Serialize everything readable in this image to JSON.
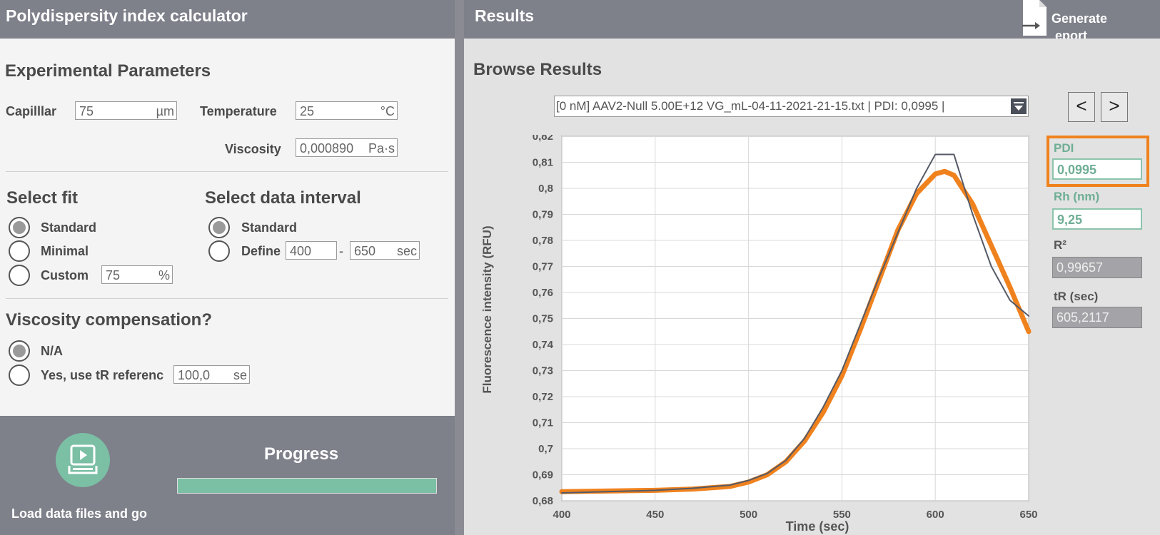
{
  "left_title": "Polydispersity index calculator",
  "right_title": "Results",
  "generate_report": {
    "line1": "Generate",
    "line2": "eport"
  },
  "experimental": {
    "title": "Experimental Parameters",
    "capillar_label": "Capilllar",
    "capillar_value": "75",
    "capillar_unit": "µm",
    "temperature_label": "Temperature",
    "temperature_value": "25",
    "temperature_unit": "°C",
    "viscosity_label": "Viscosity",
    "viscosity_value": "0,000890",
    "viscosity_unit": "Pa·s"
  },
  "fit": {
    "title": "Select fit",
    "options": [
      "Standard",
      "Minimal",
      "Custom"
    ],
    "selected": "Standard",
    "custom_value": "75",
    "custom_unit": "%"
  },
  "interval": {
    "title": "Select data interval",
    "options": [
      "Standard",
      "Define"
    ],
    "selected": "Standard",
    "from": "400",
    "dash": "-",
    "to": "650",
    "unit": "sec"
  },
  "viscosity_comp": {
    "title": "Viscosity compensation?",
    "options": [
      "N/A",
      "Yes, use tR referenc"
    ],
    "selected": "N/A",
    "ref_value": "100,0",
    "ref_unit": "se"
  },
  "load": {
    "label": "Load data files and go"
  },
  "progress": {
    "title": "Progress",
    "fraction": 1.0
  },
  "browse": {
    "title": "Browse Results",
    "selected_file": "[0 nM] AAV2-Null 5.00E+12 VG_mL-04-11-2021-21-15.txt | PDI:  0,0995 |",
    "prev": "<",
    "next": ">"
  },
  "results": {
    "pdi_label": "PDI",
    "pdi_value": "0,0995",
    "rh_label": "Rh (nm)",
    "rh_value": "9,25",
    "r2_label": "R²",
    "r2_value": "0,99657",
    "tr_label": "tR (sec)",
    "tr_value": "605,2117"
  },
  "colors": {
    "accent_orange": "#f0821e",
    "accent_green": "#6fae96",
    "header": "#7e808a"
  },
  "chart_data": {
    "type": "line",
    "xlabel": "Time (sec)",
    "ylabel": "Fluorescence intensity (RFU)",
    "xlim": [
      400,
      650
    ],
    "ylim": [
      0.68,
      0.82
    ],
    "xticks": [
      400,
      450,
      500,
      550,
      600,
      650
    ],
    "yticks": [
      "0,68",
      "0,69",
      "0,7",
      "0,71",
      "0,72",
      "0,73",
      "0,74",
      "0,75",
      "0,76",
      "0,77",
      "0,78",
      "0,79",
      "0,8",
      "0,81",
      "0,82"
    ],
    "grid": true,
    "series": [
      {
        "color": "#f0821e",
        "x": [
          400,
          450,
          470,
          490,
          500,
          510,
          520,
          530,
          540,
          550,
          560,
          570,
          580,
          590,
          600,
          605,
          610,
          620,
          630,
          640,
          650
        ],
        "y": [
          0.6835,
          0.684,
          0.6845,
          0.6855,
          0.6872,
          0.69,
          0.695,
          0.703,
          0.714,
          0.728,
          0.746,
          0.765,
          0.784,
          0.798,
          0.8055,
          0.8065,
          0.805,
          0.794,
          0.778,
          0.762,
          0.745
        ]
      },
      {
        "color": "#555a66",
        "x": [
          400,
          450,
          470,
          490,
          500,
          510,
          520,
          530,
          540,
          550,
          560,
          570,
          580,
          590,
          600,
          610,
          620,
          630,
          640,
          650
        ],
        "y": [
          0.683,
          0.684,
          0.6848,
          0.686,
          0.6878,
          0.6905,
          0.6955,
          0.704,
          0.716,
          0.73,
          0.748,
          0.766,
          0.783,
          0.8,
          0.813,
          0.813,
          0.79,
          0.77,
          0.757,
          0.751
        ]
      }
    ]
  }
}
